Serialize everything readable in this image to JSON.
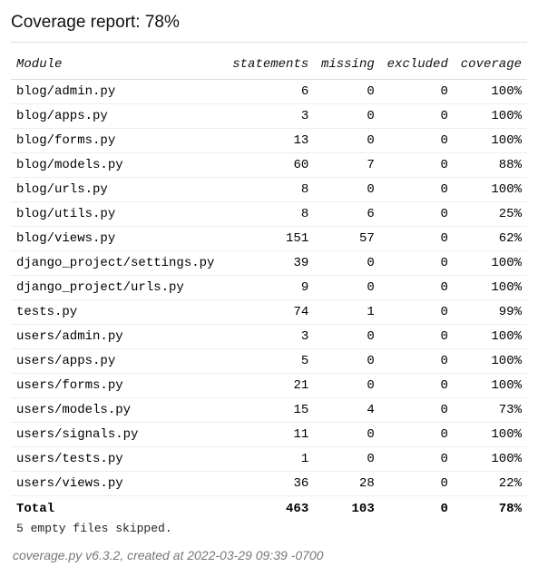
{
  "header": {
    "title": "Coverage report: 78%"
  },
  "columns": {
    "module": "Module",
    "statements": "statements",
    "missing": "missing",
    "excluded": "excluded",
    "coverage": "coverage"
  },
  "rows": [
    {
      "module": "blog/admin.py",
      "statements": 6,
      "missing": 0,
      "excluded": 0,
      "coverage": "100%"
    },
    {
      "module": "blog/apps.py",
      "statements": 3,
      "missing": 0,
      "excluded": 0,
      "coverage": "100%"
    },
    {
      "module": "blog/forms.py",
      "statements": 13,
      "missing": 0,
      "excluded": 0,
      "coverage": "100%"
    },
    {
      "module": "blog/models.py",
      "statements": 60,
      "missing": 7,
      "excluded": 0,
      "coverage": "88%"
    },
    {
      "module": "blog/urls.py",
      "statements": 8,
      "missing": 0,
      "excluded": 0,
      "coverage": "100%"
    },
    {
      "module": "blog/utils.py",
      "statements": 8,
      "missing": 6,
      "excluded": 0,
      "coverage": "25%"
    },
    {
      "module": "blog/views.py",
      "statements": 151,
      "missing": 57,
      "excluded": 0,
      "coverage": "62%"
    },
    {
      "module": "django_project/settings.py",
      "statements": 39,
      "missing": 0,
      "excluded": 0,
      "coverage": "100%"
    },
    {
      "module": "django_project/urls.py",
      "statements": 9,
      "missing": 0,
      "excluded": 0,
      "coverage": "100%"
    },
    {
      "module": "tests.py",
      "statements": 74,
      "missing": 1,
      "excluded": 0,
      "coverage": "99%"
    },
    {
      "module": "users/admin.py",
      "statements": 3,
      "missing": 0,
      "excluded": 0,
      "coverage": "100%"
    },
    {
      "module": "users/apps.py",
      "statements": 5,
      "missing": 0,
      "excluded": 0,
      "coverage": "100%"
    },
    {
      "module": "users/forms.py",
      "statements": 21,
      "missing": 0,
      "excluded": 0,
      "coverage": "100%"
    },
    {
      "module": "users/models.py",
      "statements": 15,
      "missing": 4,
      "excluded": 0,
      "coverage": "73%"
    },
    {
      "module": "users/signals.py",
      "statements": 11,
      "missing": 0,
      "excluded": 0,
      "coverage": "100%"
    },
    {
      "module": "users/tests.py",
      "statements": 1,
      "missing": 0,
      "excluded": 0,
      "coverage": "100%"
    },
    {
      "module": "users/views.py",
      "statements": 36,
      "missing": 28,
      "excluded": 0,
      "coverage": "22%"
    }
  ],
  "total": {
    "label": "Total",
    "statements": 463,
    "missing": 103,
    "excluded": 0,
    "coverage": "78%"
  },
  "skipped_note": "5 empty files skipped.",
  "footer_note": "coverage.py v6.3.2, created at 2022-03-29 09:39 -0700",
  "chart_data": {
    "type": "table",
    "title": "Coverage report: 78%",
    "columns": [
      "Module",
      "statements",
      "missing",
      "excluded",
      "coverage"
    ],
    "rows": [
      [
        "blog/admin.py",
        6,
        0,
        0,
        "100%"
      ],
      [
        "blog/apps.py",
        3,
        0,
        0,
        "100%"
      ],
      [
        "blog/forms.py",
        13,
        0,
        0,
        "100%"
      ],
      [
        "blog/models.py",
        60,
        7,
        0,
        "88%"
      ],
      [
        "blog/urls.py",
        8,
        0,
        0,
        "100%"
      ],
      [
        "blog/utils.py",
        8,
        6,
        0,
        "25%"
      ],
      [
        "blog/views.py",
        151,
        57,
        0,
        "62%"
      ],
      [
        "django_project/settings.py",
        39,
        0,
        0,
        "100%"
      ],
      [
        "django_project/urls.py",
        9,
        0,
        0,
        "100%"
      ],
      [
        "tests.py",
        74,
        1,
        0,
        "99%"
      ],
      [
        "users/admin.py",
        3,
        0,
        0,
        "100%"
      ],
      [
        "users/apps.py",
        5,
        0,
        0,
        "100%"
      ],
      [
        "users/forms.py",
        21,
        0,
        0,
        "100%"
      ],
      [
        "users/models.py",
        15,
        4,
        0,
        "73%"
      ],
      [
        "users/signals.py",
        11,
        0,
        0,
        "100%"
      ],
      [
        "users/tests.py",
        1,
        0,
        0,
        "100%"
      ],
      [
        "users/views.py",
        36,
        28,
        0,
        "22%"
      ]
    ],
    "total": [
      "Total",
      463,
      103,
      0,
      "78%"
    ]
  }
}
